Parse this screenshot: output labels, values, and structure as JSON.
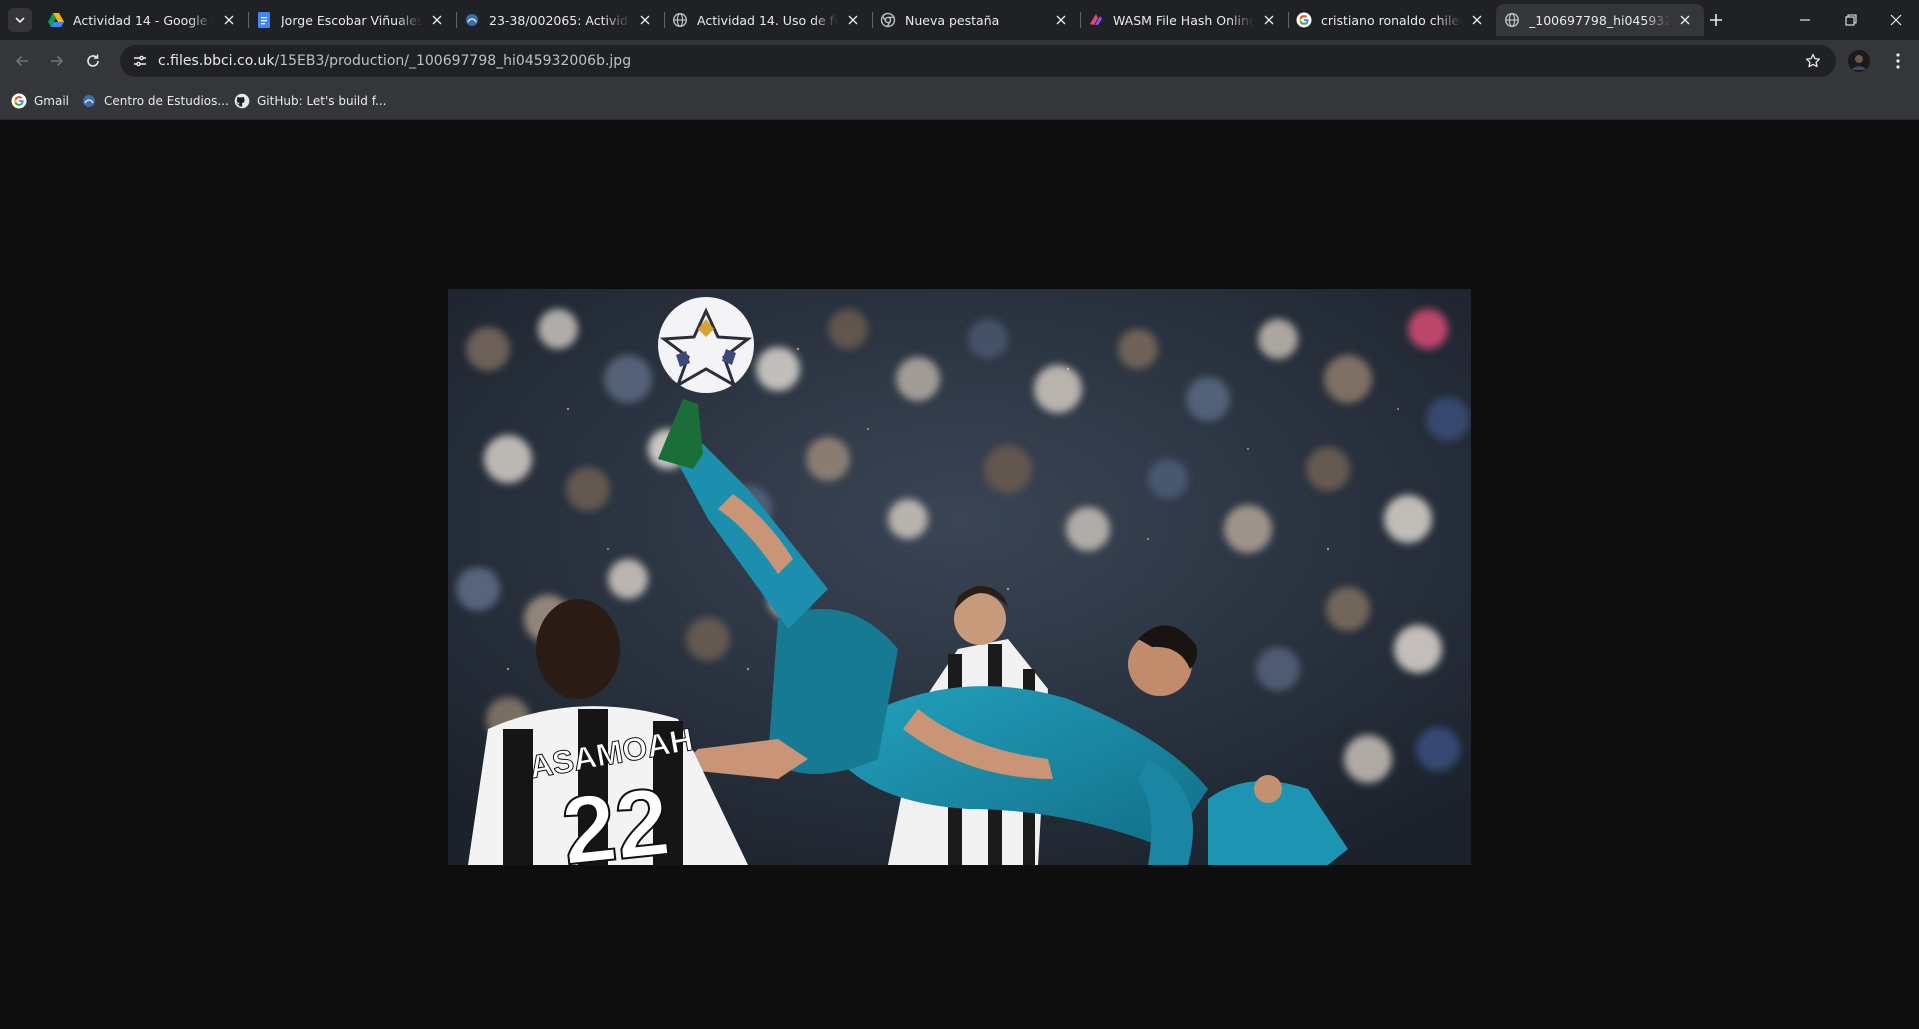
{
  "tabs": [
    {
      "title": "Actividad 14 - Google Drive",
      "icon": "google-drive-icon"
    },
    {
      "title": "Jorge Escobar Viñuales - Actividad",
      "icon": "google-docs-icon"
    },
    {
      "title": "23-38/002065: Actividad 14",
      "icon": "moodle-icon"
    },
    {
      "title": "Actividad 14. Uso de funciones",
      "icon": "globe-icon"
    },
    {
      "title": "Nueva pestaña",
      "icon": "chrome-icon"
    },
    {
      "title": "WASM File Hash Online Calculator",
      "icon": "wasm-icon"
    },
    {
      "title": "cristiano ronaldo chilena",
      "icon": "google-icon"
    },
    {
      "title": "_100697798_hi045932006b.jpg",
      "icon": "globe-icon",
      "active": true
    }
  ],
  "toolbar": {
    "url_host": "c.files.bbci.co.uk",
    "url_path": "/15EB3/production/_100697798_hi045932006b.jpg"
  },
  "bookmarks": [
    {
      "label": "Gmail",
      "icon": "google-icon"
    },
    {
      "label": "Centro de Estudios...",
      "icon": "moodle-icon"
    },
    {
      "label": "GitHub: Let's build f...",
      "icon": "github-icon"
    }
  ],
  "photo": {
    "jersey_name": "ASAMOAH",
    "jersey_number": "22"
  },
  "colors": {
    "tabstrip_bg": "#202124",
    "toolbar_bg": "#35363a",
    "page_bg": "#0e0e0e",
    "teal_kit": "#1b8aa6"
  }
}
